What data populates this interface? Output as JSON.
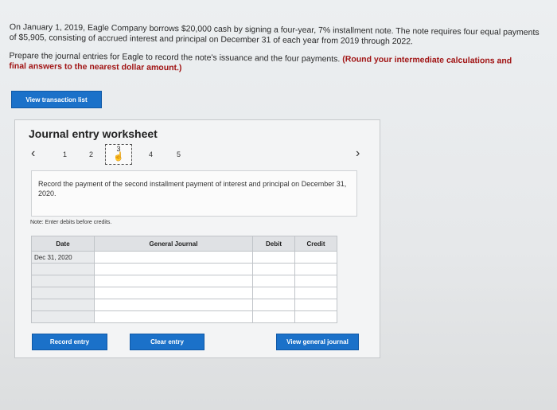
{
  "problem": {
    "p1": "On January 1, 2019, Eagle Company borrows $20,000 cash by signing a four-year, 7% installment note. The note requires four equal payments of $5,905, consisting of accrued interest and principal on December 31 of each year from 2019 through 2022.",
    "p2_prefix": "Prepare the journal entries for Eagle to record the note's issuance and the four payments.",
    "p2_highlight": "(Round your intermediate calculations and",
    "p2_bold": "final answers to the nearest dollar amount.)"
  },
  "buttons": {
    "view_transaction_list": "View transaction list",
    "record_entry": "Record entry",
    "clear_entry": "Clear entry",
    "view_general_journal": "View general journal"
  },
  "worksheet": {
    "title": "Journal entry worksheet",
    "steps": [
      "1",
      "2",
      "3",
      "4",
      "5"
    ],
    "instruction": "Record the payment of the second installment payment of interest and principal on December 31, 2020.",
    "note": "Note: Enter debits before credits."
  },
  "table": {
    "headers": {
      "date": "Date",
      "account": "General Journal",
      "debit": "Debit",
      "credit": "Credit"
    },
    "first_date": "Dec 31, 2020"
  }
}
